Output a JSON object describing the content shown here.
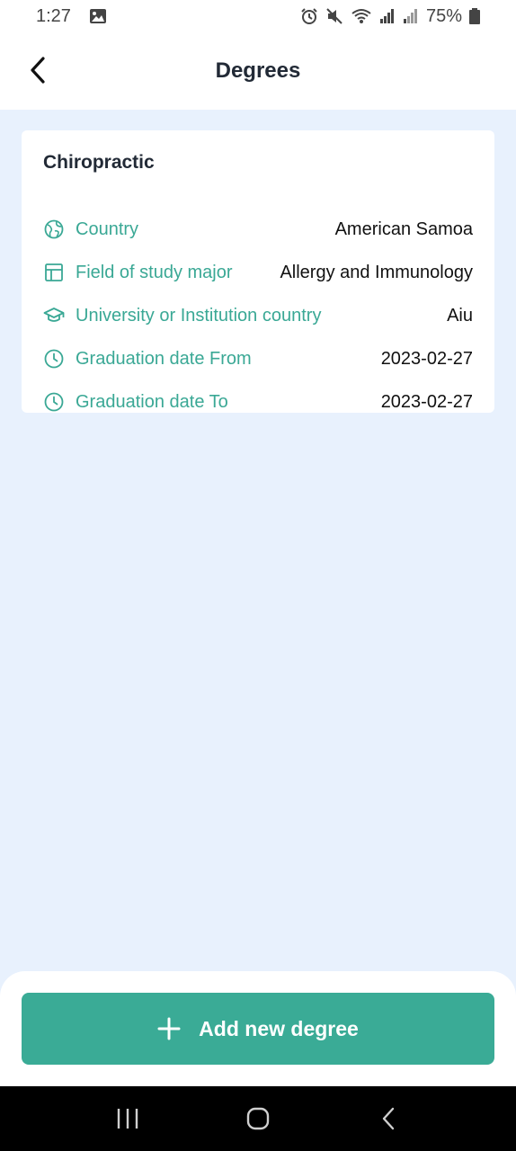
{
  "status_bar": {
    "time": "1:27",
    "battery": "75%"
  },
  "app_bar": {
    "title": "Degrees"
  },
  "degree_card": {
    "title": "Chiropractic",
    "rows": [
      {
        "icon": "globe-icon",
        "label": "Country",
        "value": "American Samoa"
      },
      {
        "icon": "layout-icon",
        "label": "Field of study major",
        "value": "Allergy and Immunology"
      },
      {
        "icon": "graduation-cap-icon",
        "label": "University or Institution country",
        "value": "Aiu"
      },
      {
        "icon": "clock-icon",
        "label": "Graduation date From",
        "value": "2023-02-27"
      },
      {
        "icon": "clock-icon",
        "label": "Graduation date To",
        "value": "2023-02-27"
      }
    ]
  },
  "actions": {
    "add_label": "Add new degree"
  },
  "colors": {
    "accent": "#3aab96",
    "background": "#e8f1fd",
    "title_text": "#222a36"
  }
}
